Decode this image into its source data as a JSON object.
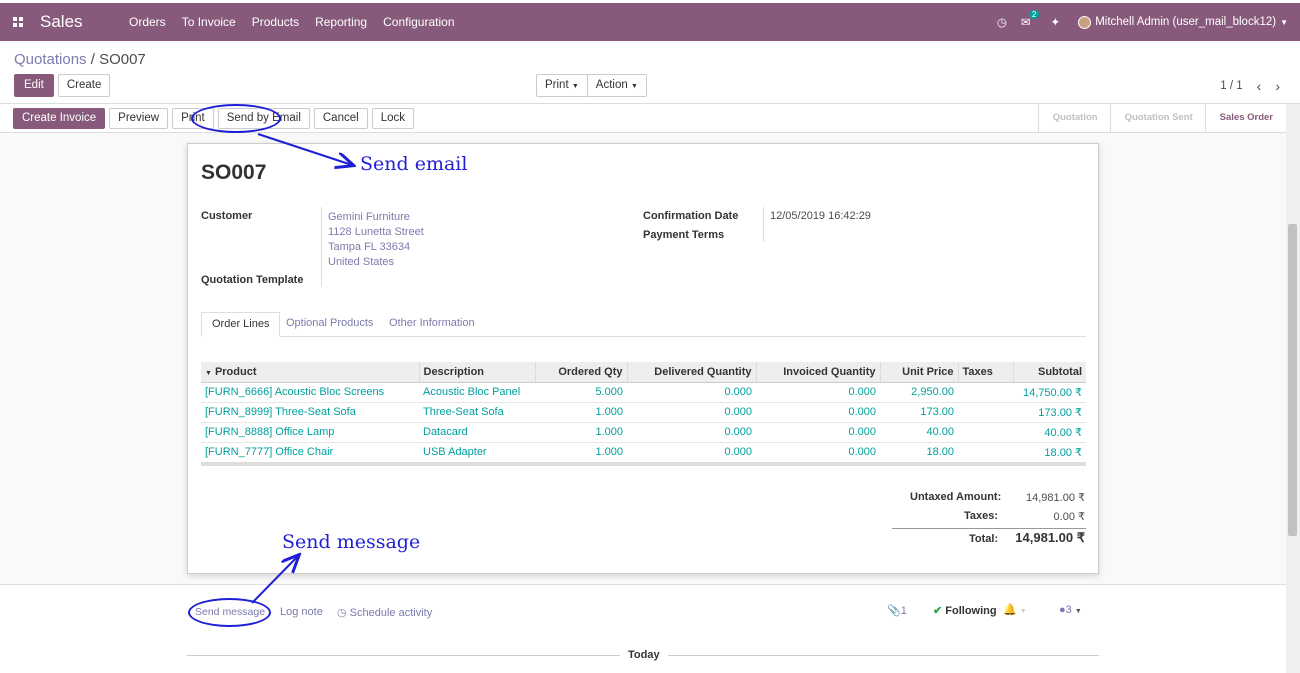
{
  "nav": {
    "brand": "Sales",
    "menu": [
      "Orders",
      "To Invoice",
      "Products",
      "Reporting",
      "Configuration"
    ],
    "message_count": "2",
    "user": "Mitchell Admin (user_mail_block12)"
  },
  "breadcrumb": {
    "parent": "Quotations",
    "separator": " / ",
    "current": "SO007"
  },
  "control": {
    "edit": "Edit",
    "create": "Create",
    "print": "Print",
    "action": "Action",
    "pager": "1 / 1"
  },
  "statusbar": {
    "buttons": [
      "Create Invoice",
      "Preview",
      "Print",
      "Send by Email",
      "Cancel",
      "Lock"
    ],
    "stages": [
      "Quotation",
      "Quotation Sent",
      "Sales Order"
    ]
  },
  "form": {
    "title": "SO007",
    "customer_label": "Customer",
    "customer_lines": [
      "Gemini Furniture",
      "1128 Lunetta Street",
      "Tampa FL 33634",
      "United States"
    ],
    "template_label": "Quotation Template",
    "confirmation_label": "Confirmation Date",
    "confirmation_value": "12/05/2019 16:42:29",
    "payment_terms_label": "Payment Terms",
    "tabs": [
      "Order Lines",
      "Optional Products",
      "Other Information"
    ],
    "columns": [
      "Product",
      "Description",
      "Ordered Qty",
      "Delivered Quantity",
      "Invoiced Quantity",
      "Unit Price",
      "Taxes",
      "Subtotal"
    ],
    "rows": [
      [
        "[FURN_6666] Acoustic Bloc Screens",
        "Acoustic Bloc Panel",
        "5.000",
        "0.000",
        "0.000",
        "2,950.00",
        "",
        "14,750.00 ₹"
      ],
      [
        "[FURN_8999] Three-Seat Sofa",
        "Three-Seat Sofa",
        "1.000",
        "0.000",
        "0.000",
        "173.00",
        "",
        "173.00 ₹"
      ],
      [
        "[FURN_8888] Office Lamp",
        "Datacard",
        "1.000",
        "0.000",
        "0.000",
        "40.00",
        "",
        "40.00 ₹"
      ],
      [
        "[FURN_7777] Office Chair",
        "USB Adapter",
        "1.000",
        "0.000",
        "0.000",
        "18.00",
        "",
        "18.00 ₹"
      ]
    ],
    "totals": {
      "untaxed_label": "Untaxed Amount:",
      "untaxed_value": "14,981.00 ₹",
      "taxes_label": "Taxes:",
      "taxes_value": "0.00 ₹",
      "total_label": "Total:",
      "total_value": "14,981.00 ₹"
    }
  },
  "chatter": {
    "send_message": "Send message",
    "log_note": "Log note",
    "schedule_activity": "Schedule activity",
    "attachments": "1",
    "following": "Following",
    "followers": "3",
    "today": "Today"
  },
  "annotations": {
    "send_email": "Send  email",
    "send_message": "Send  message"
  },
  "colors": {
    "brand": "#875a7b",
    "link": "#7c7bad",
    "teal": "#00a09d",
    "annotation": "#1f1fd6"
  }
}
